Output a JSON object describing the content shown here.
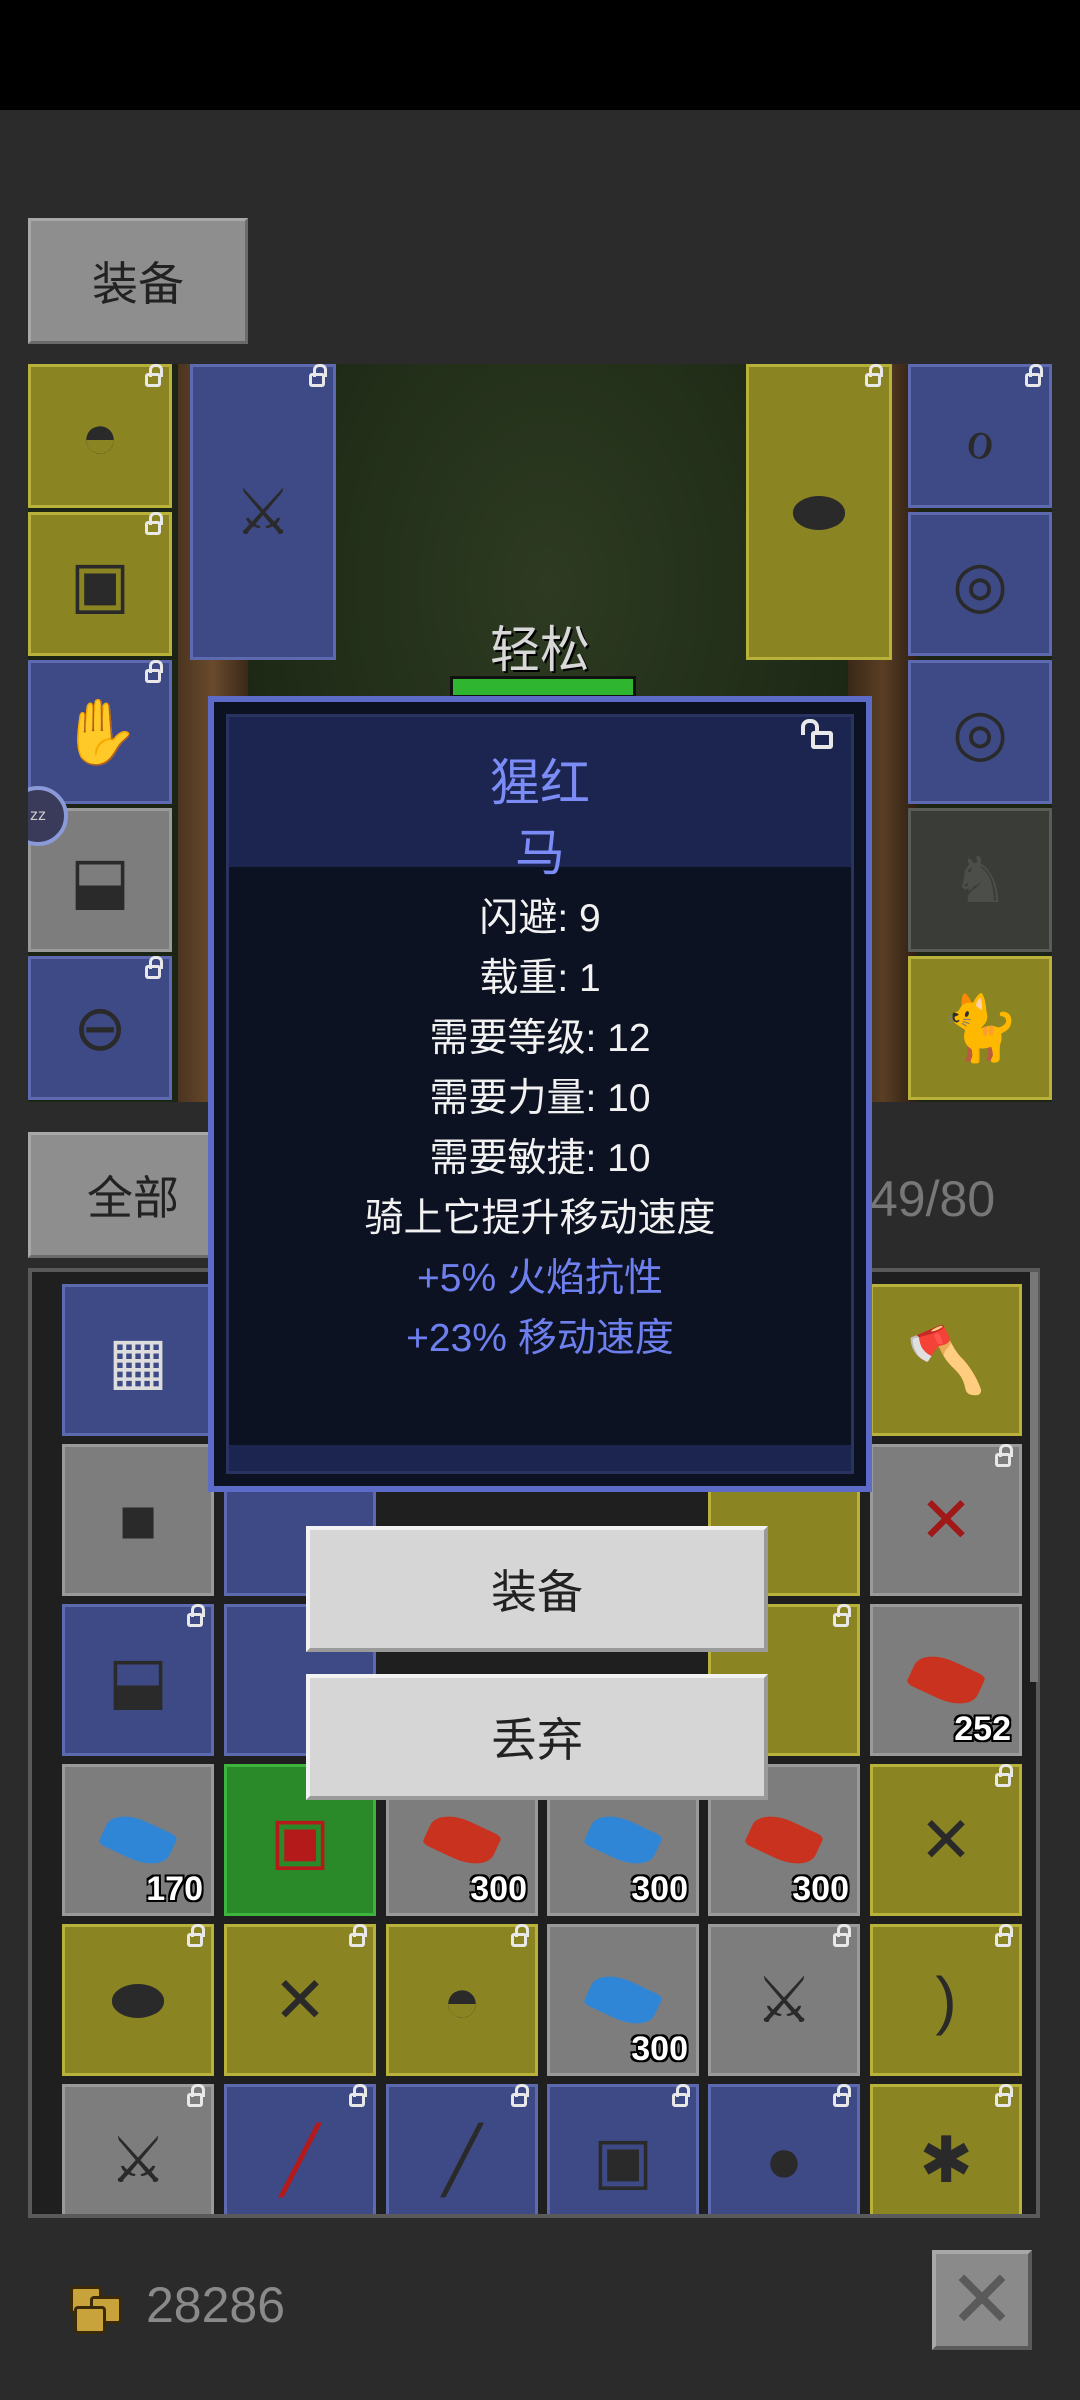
{
  "tabs": {
    "equipment": "装备",
    "all": "全部"
  },
  "hero": {
    "mood": "轻松"
  },
  "inventory": {
    "count": "49/80",
    "quantities": {
      "red_feather_a": "252",
      "blue_feather_a": "170",
      "red_feather_b": "300",
      "blue_feather_b": "300",
      "red_feather_c": "300",
      "blue_feather_c": "300"
    }
  },
  "item_dialog": {
    "title_line1": "猩红",
    "title_line2": "马",
    "stats": [
      "闪避: 9",
      "载重: 1",
      "需要等级: 12",
      "需要力量: 10",
      "需要敏捷: 10",
      "骑上它提升移动速度"
    ],
    "bonuses": [
      "+5% 火焰抗性",
      "+23% 移动速度"
    ]
  },
  "actions": {
    "equip": "装备",
    "discard": "丢弃"
  },
  "gold": "28286",
  "colors": {
    "dialog_title": "#7c8cf6",
    "bonus": "#6e80f0",
    "rarity_gold": "#8a8422",
    "rarity_blue": "#3e4a86"
  }
}
